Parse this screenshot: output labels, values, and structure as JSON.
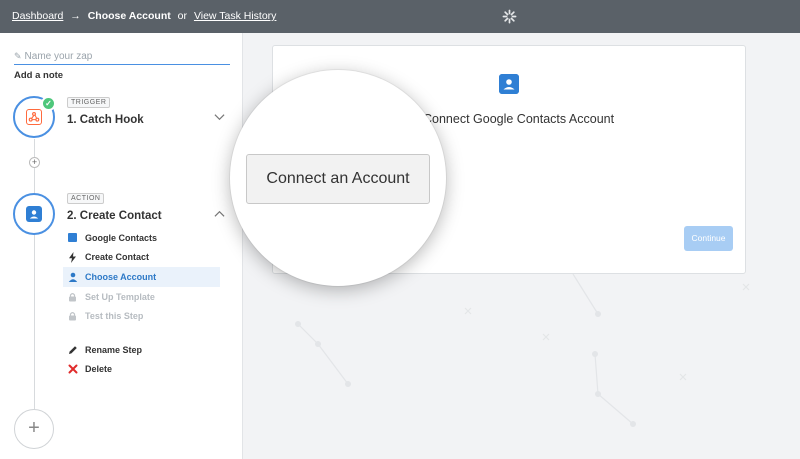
{
  "topbar": {
    "crumb_dashboard": "Dashboard",
    "crumb_arrow": "→",
    "crumb_current": "Choose Account",
    "crumb_or": "or",
    "crumb_history": "View Task History",
    "logo_icon": "zapier-asterisk-icon"
  },
  "sidebar": {
    "zap_name_placeholder": "Name your zap",
    "add_note": "Add a note",
    "trigger": {
      "tag": "TRIGGER",
      "title": "1. Catch Hook",
      "icon": "webhook-icon",
      "icon_color": "#ff6a3d"
    },
    "action": {
      "tag": "ACTION",
      "title": "2. Create Contact",
      "icon": "google-contacts-icon",
      "icon_color": "#2f7fd4"
    },
    "substeps": [
      {
        "label": "Google Contacts",
        "icon": "google-contacts-icon",
        "state": "done"
      },
      {
        "label": "Create Contact",
        "icon": "bolt-icon",
        "state": "done"
      },
      {
        "label": "Choose Account",
        "icon": "person-icon",
        "state": "active"
      },
      {
        "label": "Set Up Template",
        "icon": "lock-icon",
        "state": "disabled"
      },
      {
        "label": "Test this Step",
        "icon": "lock-icon",
        "state": "disabled"
      }
    ],
    "extras": [
      {
        "label": "Rename Step",
        "icon": "pencil-icon"
      },
      {
        "label": "Delete",
        "icon": "delete-x-icon"
      }
    ]
  },
  "main": {
    "card_title": "Connect Google Contacts Account",
    "continue_label": "Continue",
    "magnified_button": "Connect an Account"
  },
  "colors": {
    "accent": "#4a90e2",
    "topbar": "#5a6168",
    "success": "#4ec77b",
    "delete": "#e02b2b"
  }
}
